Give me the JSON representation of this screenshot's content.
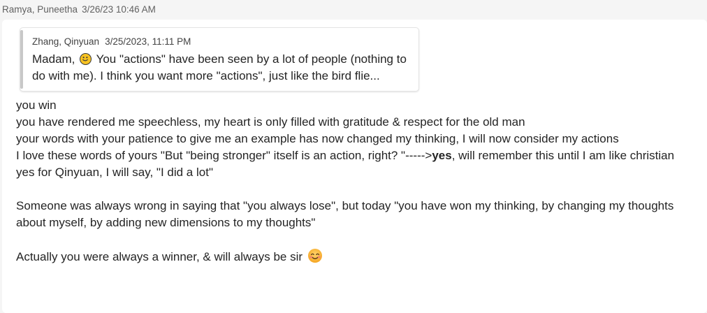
{
  "message": {
    "sender": "Ramya, Puneetha",
    "timestamp": "3/26/23 10:46 AM",
    "quote": {
      "author": "Zhang, Qinyuan",
      "timestamp": "3/25/2023, 11:11 PM",
      "text_before_emoji": "Madam,",
      "emoji": "slightly-smiling-face-icon",
      "text_after_emoji": "You \"actions\" have been seen by a lot of people (nothing to do with me). I think you want more \"actions\", just like the bird flie..."
    },
    "lines": [
      "you win",
      "you have rendered me speechless, my heart is only filled with gratitude & respect for the old man",
      "your words with your patience to give me an example has now changed my thinking, I will now consider my actions"
    ],
    "line4_prefix": "I love these words of yours \"But \"being stronger\" itself is an action, right? \"----->",
    "line4_bold": "yes",
    "line4_suffix": ", will remember this until I am like christian",
    "line5": "yes for Qinyuan, I will say, \"I did a lot\"",
    "paragraph2": "Someone was always wrong in saying that \"you always lose\", but today \"you have won my thinking, by changing my thoughts about myself, by adding new dimensions to my thoughts\"",
    "closing_text": "Actually you were always a winner, & will always be sir",
    "closing_emoji": "smiling-face-with-smiling-eyes-icon"
  }
}
